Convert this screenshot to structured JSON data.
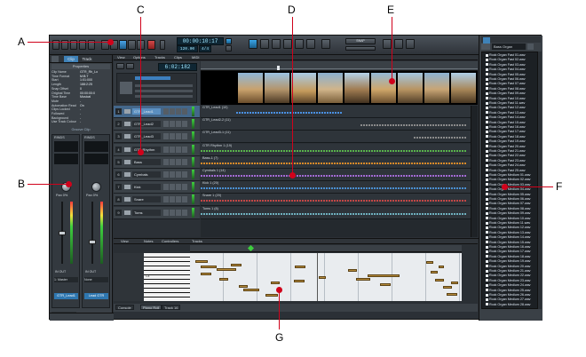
{
  "callouts": {
    "A": "A",
    "B": "B",
    "C": "C",
    "D": "D",
    "E": "E",
    "F": "F",
    "G": "G"
  },
  "toolbar": {
    "now_time": "00:00:10:17",
    "tempo": "120.00",
    "meter": "4/4",
    "snap_dropdown": "SNAP"
  },
  "inspector": {
    "tabs": [
      "Clip",
      "Track"
    ],
    "properties_title": "Properties",
    "props": [
      [
        "Clip Name",
        "GTR_Rh_Lo"
      ],
      [
        "Time Format",
        "M:B:T"
      ],
      [
        "Start",
        "1:01:000"
      ],
      [
        "Length",
        "188:2:25"
      ],
      [
        "Snap Offset",
        "0"
      ],
      [
        "Original Time",
        "00:00:00:0"
      ],
      [
        "Time Base",
        "Musical"
      ],
      [
        "Mute",
        "-"
      ],
      [
        "Automation Read",
        "On"
      ],
      [
        "Clips Locked",
        "-"
      ],
      [
        "Followed",
        "-"
      ],
      [
        "Background",
        "-"
      ],
      [
        "Use Track Colour",
        "-"
      ]
    ],
    "groove_clip": "Groove Clip",
    "strip_labels": [
      "RINDS",
      "RINDS"
    ],
    "pan_labels": [
      "Pan 0%",
      "Pan 0%"
    ],
    "output_labels": [
      "IN OUT",
      "IN OUT"
    ],
    "route": [
      "1: Master",
      "None"
    ],
    "track_name_a": "GTR_Lead1",
    "track_name_b": "Lead GTR",
    "display": "Display"
  },
  "trackview": {
    "menus": [
      "View",
      "Options",
      "Tracks",
      "Clips",
      "MIDI"
    ],
    "time_display": "6:02:182",
    "tracks": [
      {
        "num": "1",
        "name": "GTR_Lead1",
        "selected": true,
        "clip": "GTR_Lead1 (10)",
        "color": "#4a90e2"
      },
      {
        "num": "2",
        "name": "GTR_Lead2",
        "selected": false,
        "clip": "GTR_Lead2-2 (11)",
        "color": "#8a8a8a"
      },
      {
        "num": "3",
        "name": "GTR_Lead3",
        "selected": false,
        "clip": "GTR_Lead3-1 (11)",
        "color": "#8a8a8a"
      },
      {
        "num": "4",
        "name": "GTR Rhythm",
        "selected": false,
        "clip": "GTR Rhythm 1 (19)",
        "color": "#58b34b"
      },
      {
        "num": "5",
        "name": "Bass",
        "selected": false,
        "clip": "Bass-1 (7)",
        "color": "#d88a2a"
      },
      {
        "num": "6",
        "name": "Cymbals",
        "selected": false,
        "clip": "Cymbals 1 (14)",
        "color": "#a36ad4"
      },
      {
        "num": "7",
        "name": "Kick",
        "selected": false,
        "clip": "Kick 1 (20)",
        "color": "#4a8fd1"
      },
      {
        "num": "8",
        "name": "Snare",
        "selected": false,
        "clip": "Snare 1 (20)",
        "color": "#c24646"
      },
      {
        "num": "9",
        "name": "Toms",
        "selected": false,
        "clip": "Toms 1 (8)",
        "color": "#6fb1bf"
      }
    ],
    "arranger_label": "Arranger name"
  },
  "pianoroll": {
    "menus": [
      "View",
      "Notes",
      "Controllers",
      "Tracks"
    ],
    "keyboard_label": "C4",
    "bottom_tabs": [
      "Console",
      "Piano Roll",
      "Track 16"
    ]
  },
  "browser": {
    "dropdown": "Bass Organ",
    "items": [
      "Rock Organ Fast 01.wav",
      "Rock Organ Fast 02.wav",
      "Rock Organ Fast 03.wav",
      "Rock Organ Fast 04.wav",
      "Rock Organ Fast 05.wav",
      "Rock Organ Fast 06.wav",
      "Rock Organ Fast 07.wav",
      "Rock Organ Fast 08.wav",
      "Rock Organ Fast 09.wav",
      "Rock Organ Fast 10.wav",
      "Rock Organ Fast 11.wav",
      "Rock Organ Fast 12.wav",
      "Rock Organ Fast 13.wav",
      "Rock Organ Fast 14.wav",
      "Rock Organ Fast 15.wav",
      "Rock Organ Fast 16.wav",
      "Rock Organ Fast 17.wav",
      "Rock Organ Fast 18.wav",
      "Rock Organ Fast 19.wav",
      "Rock Organ Fast 20.wav",
      "Rock Organ Fast 21.wav",
      "Rock Organ Fast 22.wav",
      "Rock Organ Fast 23.wav",
      "Rock Organ Fast 24.wav",
      "Rock Organ Fast 25.wav",
      "Rock Organ Medium 01.wav",
      "Rock Organ Medium 02.wav",
      "Rock Organ Medium 03.wav",
      "Rock Organ Medium 04.wav",
      "Rock Organ Medium 05.wav",
      "Rock Organ Medium 06.wav",
      "Rock Organ Medium 07.wav",
      "Rock Organ Medium 08.wav",
      "Rock Organ Medium 09.wav",
      "Rock Organ Medium 10.wav",
      "Rock Organ Medium 11.wav",
      "Rock Organ Medium 12.wav",
      "Rock Organ Medium 13.wav",
      "Rock Organ Medium 14.wav",
      "Rock Organ Medium 15.wav",
      "Rock Organ Medium 16.wav",
      "Rock Organ Medium 17.wav",
      "Rock Organ Medium 18.wav",
      "Rock Organ Medium 19.wav",
      "Rock Organ Medium 20.wav",
      "Rock Organ Medium 21.wav",
      "Rock Organ Medium 22.wav",
      "Rock Organ Medium 23.wav",
      "Rock Organ Medium 24.wav",
      "Rock Organ Medium 25.wav",
      "Rock Organ Medium 26.wav",
      "Rock Organ Medium 27.wav",
      "Rock Organ Medium 28.wav"
    ]
  },
  "colors": {
    "accent": "#d0021b",
    "lcd": "#9fe6ff",
    "selected_track": "#44678a"
  }
}
